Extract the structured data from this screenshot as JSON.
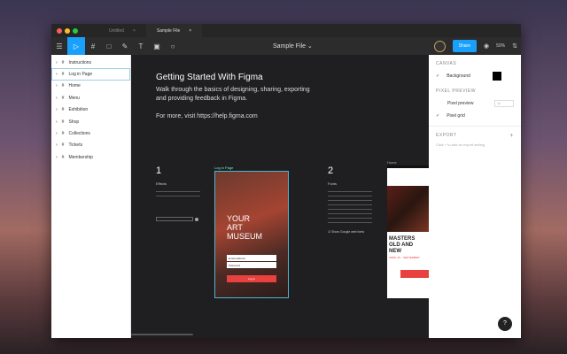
{
  "tabs": [
    {
      "label": "Untitled"
    },
    {
      "label": "Sample File"
    }
  ],
  "toolbar": {
    "filename": "Sample File",
    "share": "Share",
    "zoom": "50%"
  },
  "layers": [
    {
      "label": "Instructions"
    },
    {
      "label": "Log in Page"
    },
    {
      "label": "Home"
    },
    {
      "label": "Menu"
    },
    {
      "label": "Exhibition"
    },
    {
      "label": "Shop"
    },
    {
      "label": "Collections"
    },
    {
      "label": "Tickets"
    },
    {
      "label": "Membership"
    }
  ],
  "canvas": {
    "title": "Getting Started With Figma",
    "intro": "Walk through the basics of designing, sharing, exporting and providing feedback in Figma.",
    "more": "For more, visit https://help.figma.com",
    "step1": {
      "num": "1",
      "title": "Effects"
    },
    "step2": {
      "num": "2",
      "title": "Fonts",
      "checkbox": "Show Google web fonts"
    },
    "frame1": {
      "label": "Log in Page",
      "line1": "YOUR",
      "line2": "ART",
      "line3": "MUSEUM",
      "email": "Email address",
      "password": "Password",
      "button": "Log in"
    },
    "frame2": {
      "label": "Home",
      "head1": "MASTERS",
      "head2": "OLD AND",
      "head3": "NEW",
      "dates": "APRIL 15 – SEPTEMBER"
    }
  },
  "panel": {
    "canvas": "CANVAS",
    "background": "Background",
    "bg_color": "#000000",
    "pixel_preview": "PIXEL PREVIEW",
    "pixel_preview_label": "Pixel preview",
    "pixel_preview_value": "1x",
    "pixel_grid": "Pixel grid",
    "export": "EXPORT",
    "export_hint": "Click + to add an export setting"
  },
  "help": "?"
}
